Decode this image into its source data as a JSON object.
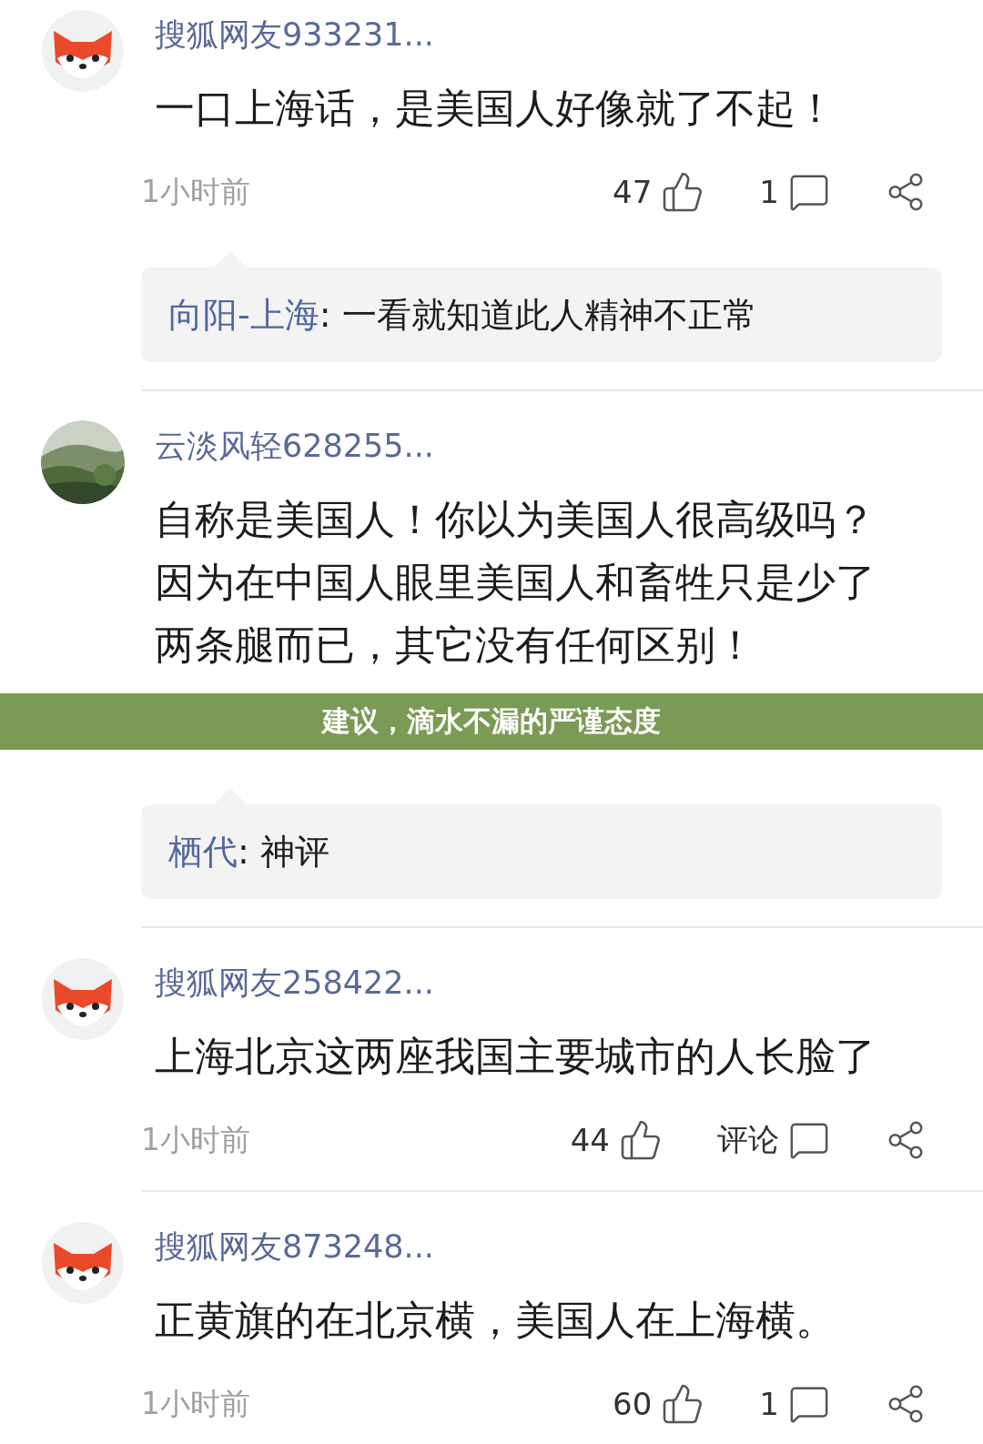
{
  "comments": [
    {
      "avatar": {
        "kind": "fox"
      },
      "name": "搜狐网友933231...",
      "lines": [
        "一口上海话，是美国人好像就了不起！"
      ],
      "time": "1小时前",
      "likes": "47",
      "replies_label": "1",
      "reply": {
        "author": "向阳-上海",
        "text": ": 一看就知道此人精神不正常"
      }
    },
    {
      "avatar": {
        "kind": "picture"
      },
      "name": "云淡风轻628255...",
      "lines": [
        "自称是美国人！你以为美国人很高级吗？",
        "因为在中国人眼里美国人和畜牲只是少了",
        "两条腿而已，其它没有任何区别！"
      ],
      "reply": {
        "author": "栖代",
        "text": ": 神评"
      }
    },
    {
      "avatar": {
        "kind": "fox"
      },
      "name": "搜狐网友258422...",
      "lines": [
        "上海北京这两座我国主要城市的人长脸了"
      ],
      "time": "1小时前",
      "likes": "44",
      "replies_label": "评论"
    },
    {
      "avatar": {
        "kind": "fox"
      },
      "name": "搜狐网友873248...",
      "lines": [
        "正黄旗的在北京横，美国人在上海横。"
      ],
      "time": "1小时前",
      "likes": "60",
      "replies_label": "1"
    }
  ],
  "banner": {
    "text": "建议，滴水不漏的严谨态度"
  }
}
